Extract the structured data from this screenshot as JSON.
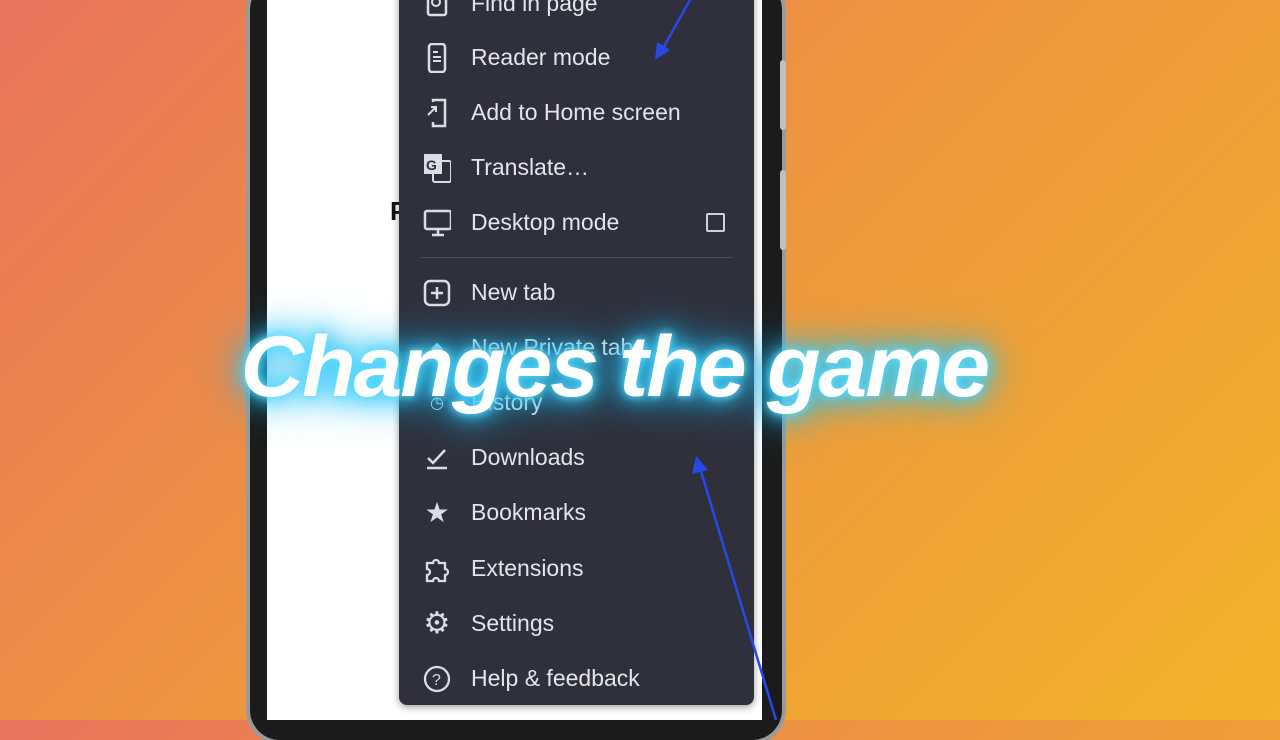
{
  "menu": {
    "items": [
      {
        "label": "Find in page",
        "icon": "find-in-page-icon"
      },
      {
        "label": "Reader mode",
        "icon": "reader-mode-icon"
      },
      {
        "label": "Add to Home screen",
        "icon": "add-to-home-icon"
      },
      {
        "label": "Translate…",
        "icon": "translate-icon"
      },
      {
        "label": "Desktop mode",
        "icon": "desktop-icon",
        "checked": false
      },
      {
        "label": "New tab",
        "icon": "new-tab-icon"
      },
      {
        "label": "New Private tab",
        "icon": "private-tab-icon"
      },
      {
        "label": "History",
        "icon": "history-icon"
      },
      {
        "label": "Downloads",
        "icon": "downloads-icon"
      },
      {
        "label": "Bookmarks",
        "icon": "star-icon"
      },
      {
        "label": "Extensions",
        "icon": "puzzle-icon"
      },
      {
        "label": "Settings",
        "icon": "gear-icon"
      },
      {
        "label": "Help & feedback",
        "icon": "help-icon"
      }
    ]
  },
  "page": {
    "partial_text": "P"
  },
  "overlay": {
    "caption": "Changes the game"
  },
  "colors": {
    "menu_bg": "#2f303c",
    "arrow": "#2848e8",
    "glow": "#3fd0ff"
  }
}
